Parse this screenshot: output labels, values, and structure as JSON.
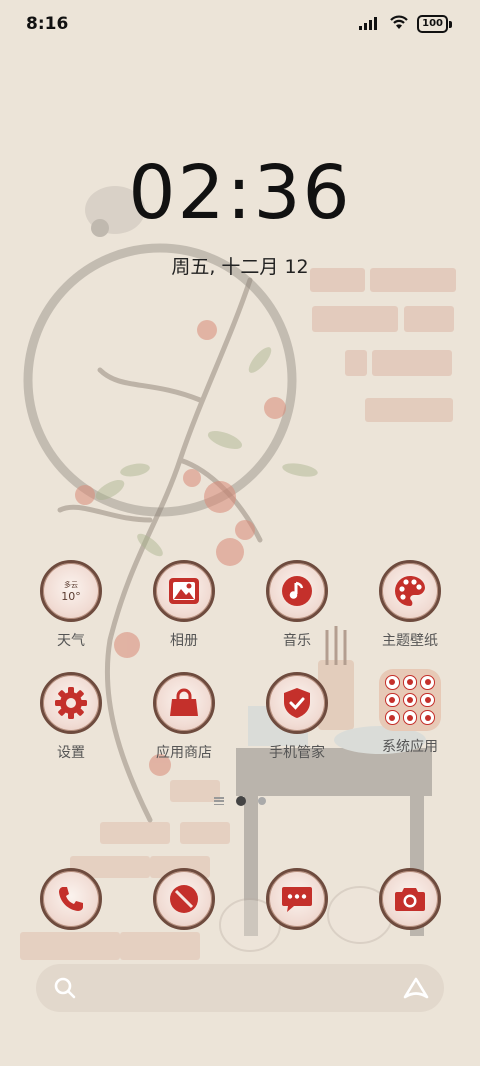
{
  "status_bar": {
    "time": "8:16",
    "battery": "100",
    "signal_icon": "signal-icon",
    "wifi_icon": "wifi-icon"
  },
  "lock": {
    "clock": "02:36",
    "date": "周五, 十二月 12"
  },
  "weather_widget": {
    "condition": "多云",
    "temp": "10°"
  },
  "apps_row1": [
    {
      "label": "天气",
      "icon": "weather-icon"
    },
    {
      "label": "相册",
      "icon": "gallery-icon"
    },
    {
      "label": "音乐",
      "icon": "music-icon"
    },
    {
      "label": "主题壁纸",
      "icon": "themes-icon"
    }
  ],
  "apps_row2": [
    {
      "label": "设置",
      "icon": "settings-icon"
    },
    {
      "label": "应用商店",
      "icon": "app-store-icon"
    },
    {
      "label": "手机管家",
      "icon": "security-icon"
    },
    {
      "label": "系统应用",
      "icon": "system-apps-folder"
    }
  ],
  "dock": [
    {
      "icon": "phone-icon"
    },
    {
      "icon": "browser-icon"
    },
    {
      "icon": "messages-icon"
    },
    {
      "icon": "camera-icon"
    }
  ],
  "colors": {
    "accent_red": "#c4302b",
    "ring": "#6e4b3e",
    "background": "#ece4d8"
  }
}
